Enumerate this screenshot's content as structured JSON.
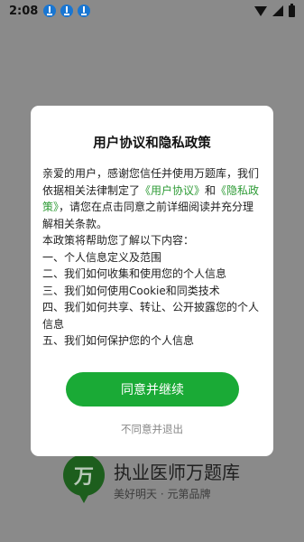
{
  "status_bar": {
    "time": "2:08",
    "notification_icons": [
      "download-icon",
      "download-icon",
      "download-icon"
    ],
    "right_icons": [
      "wifi-icon",
      "signal-icon",
      "battery-icon"
    ]
  },
  "background": {
    "logo_char": "万",
    "app_name": "执业医师万题库",
    "slogan": "美好明天 · 元第品牌"
  },
  "dialog": {
    "title": "用户协议和隐私政策",
    "intro_prefix": "亲爱的用户，感谢您信任并使用万题库，我们依据相关法律制定了",
    "user_agreement_link": "《用户协议》",
    "and_text": "和",
    "privacy_policy_link": "《隐私政策》",
    "intro_suffix": "，请您在点击同意之前详细阅读并充分理解相关条款。",
    "help_intro": "本政策将帮助您了解以下内容：",
    "items": [
      "一、个人信息定义及范围",
      "二、我们如何收集和使用您的个人信息",
      "三、我们如何使用Cookie和同类技术",
      "四、我们如何共享、转让、公开披露您的个人信息",
      "五、我们如何保护您的个人信息"
    ],
    "agree_label": "同意并继续",
    "decline_label": "不同意并退出"
  },
  "colors": {
    "accent_green": "#1aaa36",
    "link_green": "#2e9b36",
    "overlay": "#8a8a8a"
  }
}
